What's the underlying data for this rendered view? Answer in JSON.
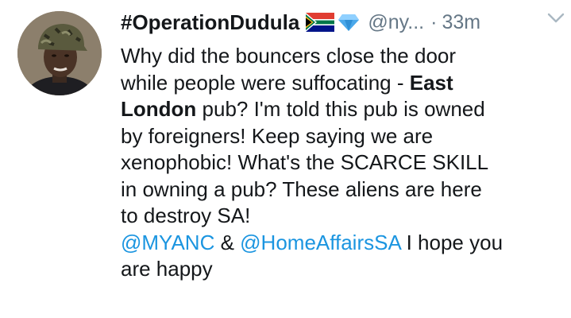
{
  "tweet": {
    "display_name": "#OperationDudula",
    "handle": "@ny...",
    "separator": "·",
    "timestamp": "33m",
    "badges": [
      "south-africa-flag-icon",
      "gem-icon"
    ],
    "text": {
      "l1": "Why did the bouncers close the door",
      "l2a": "while people were suffocating - ",
      "l2b": "East",
      "l3a": "London",
      "l3b": " pub? I'm told this pub is owned",
      "l4": "by foreigners! Keep saying we are",
      "l5": "xenophobic! What's the SCARCE SKILL",
      "l6": "in owning a pub? These aliens are here",
      "l7": "to destroy SA!",
      "mention1": "@MYANC",
      "amp": " & ",
      "mention2": "@HomeAffairsSA",
      "l8rest": " I hope you",
      "l9": "are happy"
    },
    "colors": {
      "text": "#14171a",
      "secondary": "#657786",
      "link": "#1b95e0"
    }
  }
}
